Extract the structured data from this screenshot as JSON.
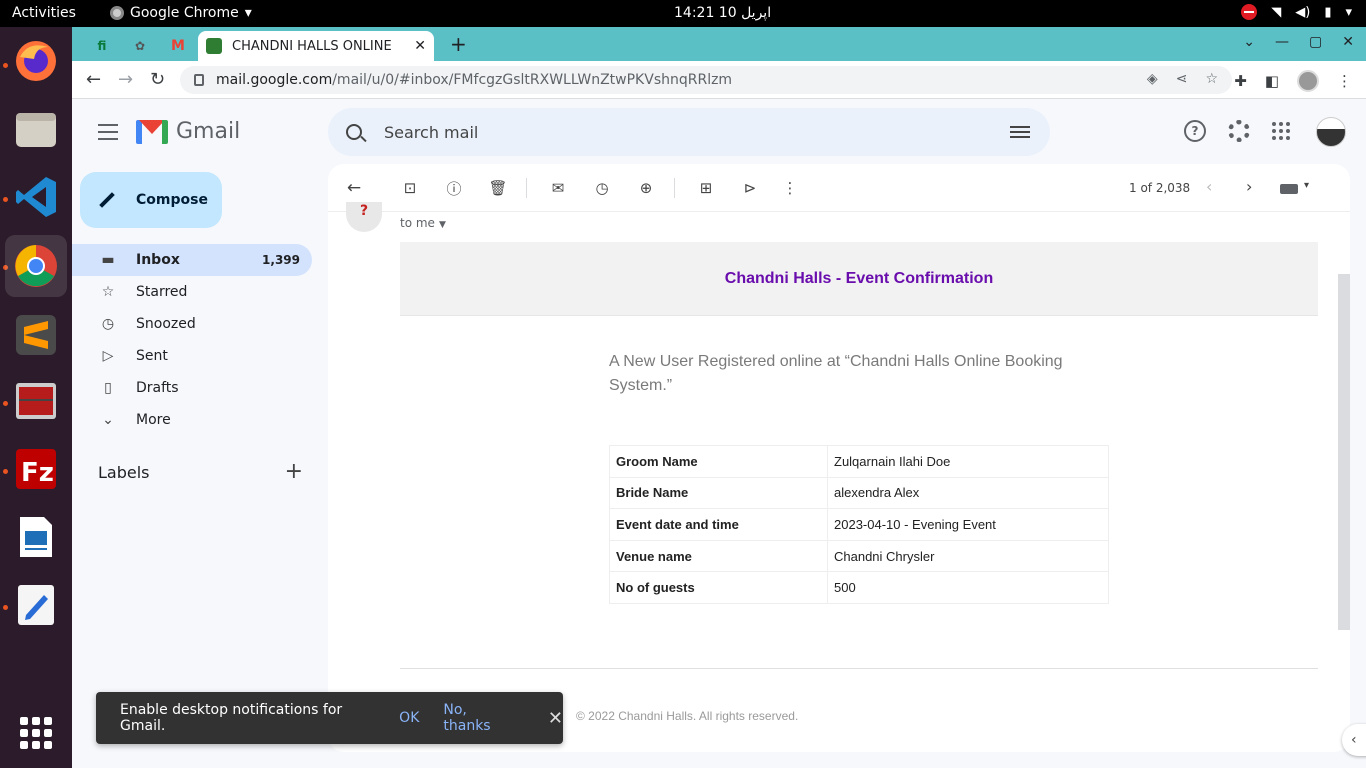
{
  "system": {
    "activities": "Activities",
    "app_name": "Google Chrome",
    "clock": "14:21  اپریل 10"
  },
  "browser": {
    "active_tab_title": "CHANDNI HALLS ONLINE",
    "url_host": "mail.google.com",
    "url_path": "/mail/u/0/#inbox/FMfcgzGsltRXWLLWnZtwPKVshnqRRlzm"
  },
  "gmail": {
    "logo_text": "Gmail",
    "search_placeholder": "Search mail",
    "compose_label": "Compose",
    "nav": [
      {
        "label": "Inbox",
        "count": "1,399",
        "icon": "inbox-icon"
      },
      {
        "label": "Starred",
        "count": "",
        "icon": "star-icon"
      },
      {
        "label": "Snoozed",
        "count": "",
        "icon": "clock-icon"
      },
      {
        "label": "Sent",
        "count": "",
        "icon": "send-icon"
      },
      {
        "label": "Drafts",
        "count": "",
        "icon": "draft-icon"
      },
      {
        "label": "More",
        "count": "",
        "icon": "chevron-down-icon"
      }
    ],
    "labels_header": "Labels",
    "pager_text": "1 of 2,038"
  },
  "message": {
    "sender_initial": "?",
    "to_me": "to me",
    "header": "Chandni Halls - Event Confirmation",
    "intro": "A New User Registered online at “Chandni Halls Online Booking System.”",
    "table": [
      {
        "key": "Groom Name",
        "value": "Zulqarnain Ilahi Doe"
      },
      {
        "key": "Bride Name",
        "value": "alexendra Alex"
      },
      {
        "key": "Event date and time",
        "value": "2023-04-10 - Evening Event"
      },
      {
        "key": "Venue name",
        "value": "Chandni Chrysler"
      },
      {
        "key": "No of guests",
        "value": "500"
      }
    ],
    "footer": "© 2022 Chandni Halls. All rights reserved."
  },
  "snackbar": {
    "message": "Enable desktop notifications for Gmail.",
    "ok": "OK",
    "no_thanks": "No, thanks"
  },
  "colors": {
    "tab_strip": "#5bc0c6",
    "header_text": "#6a0dad",
    "inbox_active": "#d3e3fd",
    "compose_bg": "#c2e7ff"
  }
}
